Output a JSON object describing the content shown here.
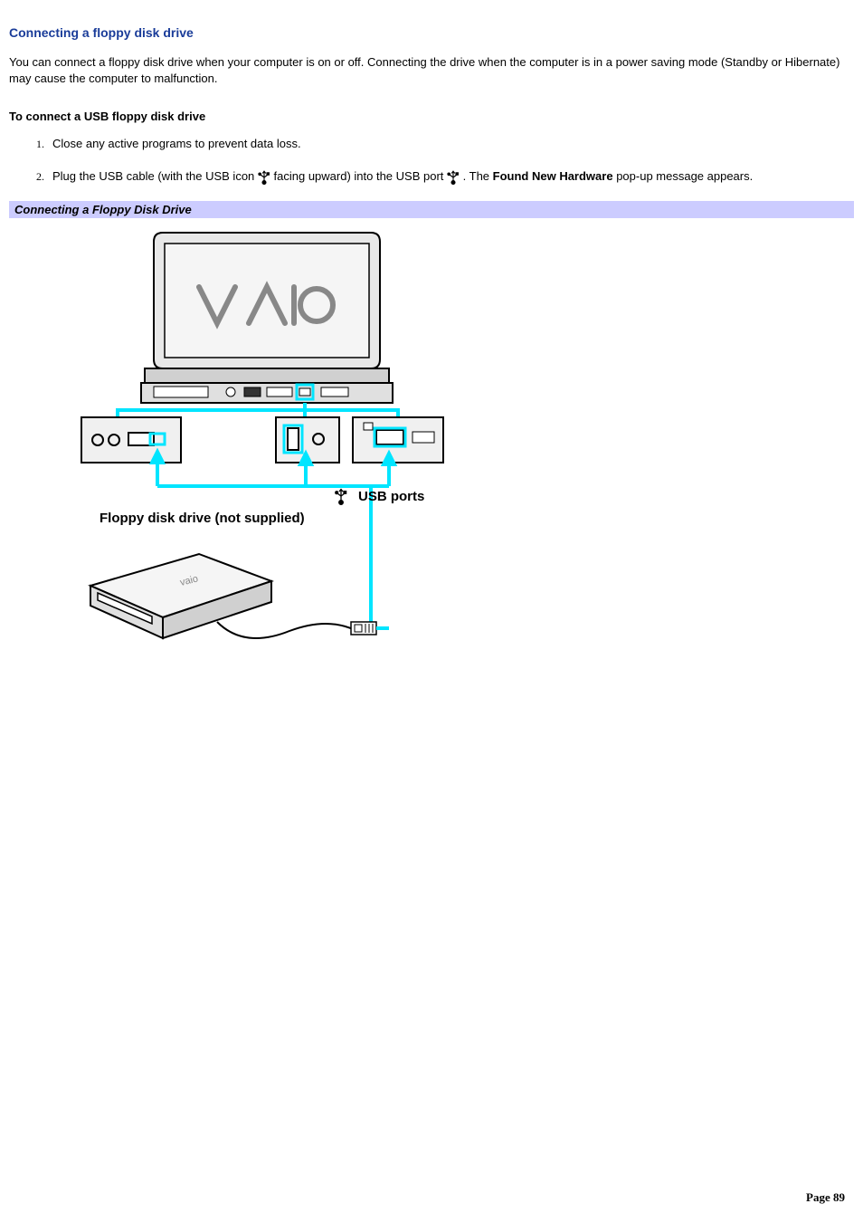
{
  "title": "Connecting a floppy disk drive",
  "intro": "You can connect a floppy disk drive when your computer is on or off. Connecting the drive when the computer is in a power saving mode (Standby or Hibernate) may cause the computer to malfunction.",
  "subhead": "To connect a USB floppy disk drive",
  "steps": {
    "s1": "Close any active programs to prevent data loss.",
    "s2_a": "Plug the USB cable (with the USB icon ",
    "s2_b": " facing upward) into the USB port ",
    "s2_c": " . The ",
    "s2_bold": "Found New Hardware",
    "s2_d": " pop-up message appears."
  },
  "caption": "Connecting a Floppy Disk Drive",
  "figure": {
    "usb_ports_label": "USB ports",
    "floppy_label": "Floppy disk drive (not supplied)"
  },
  "page_label": "Page 89"
}
